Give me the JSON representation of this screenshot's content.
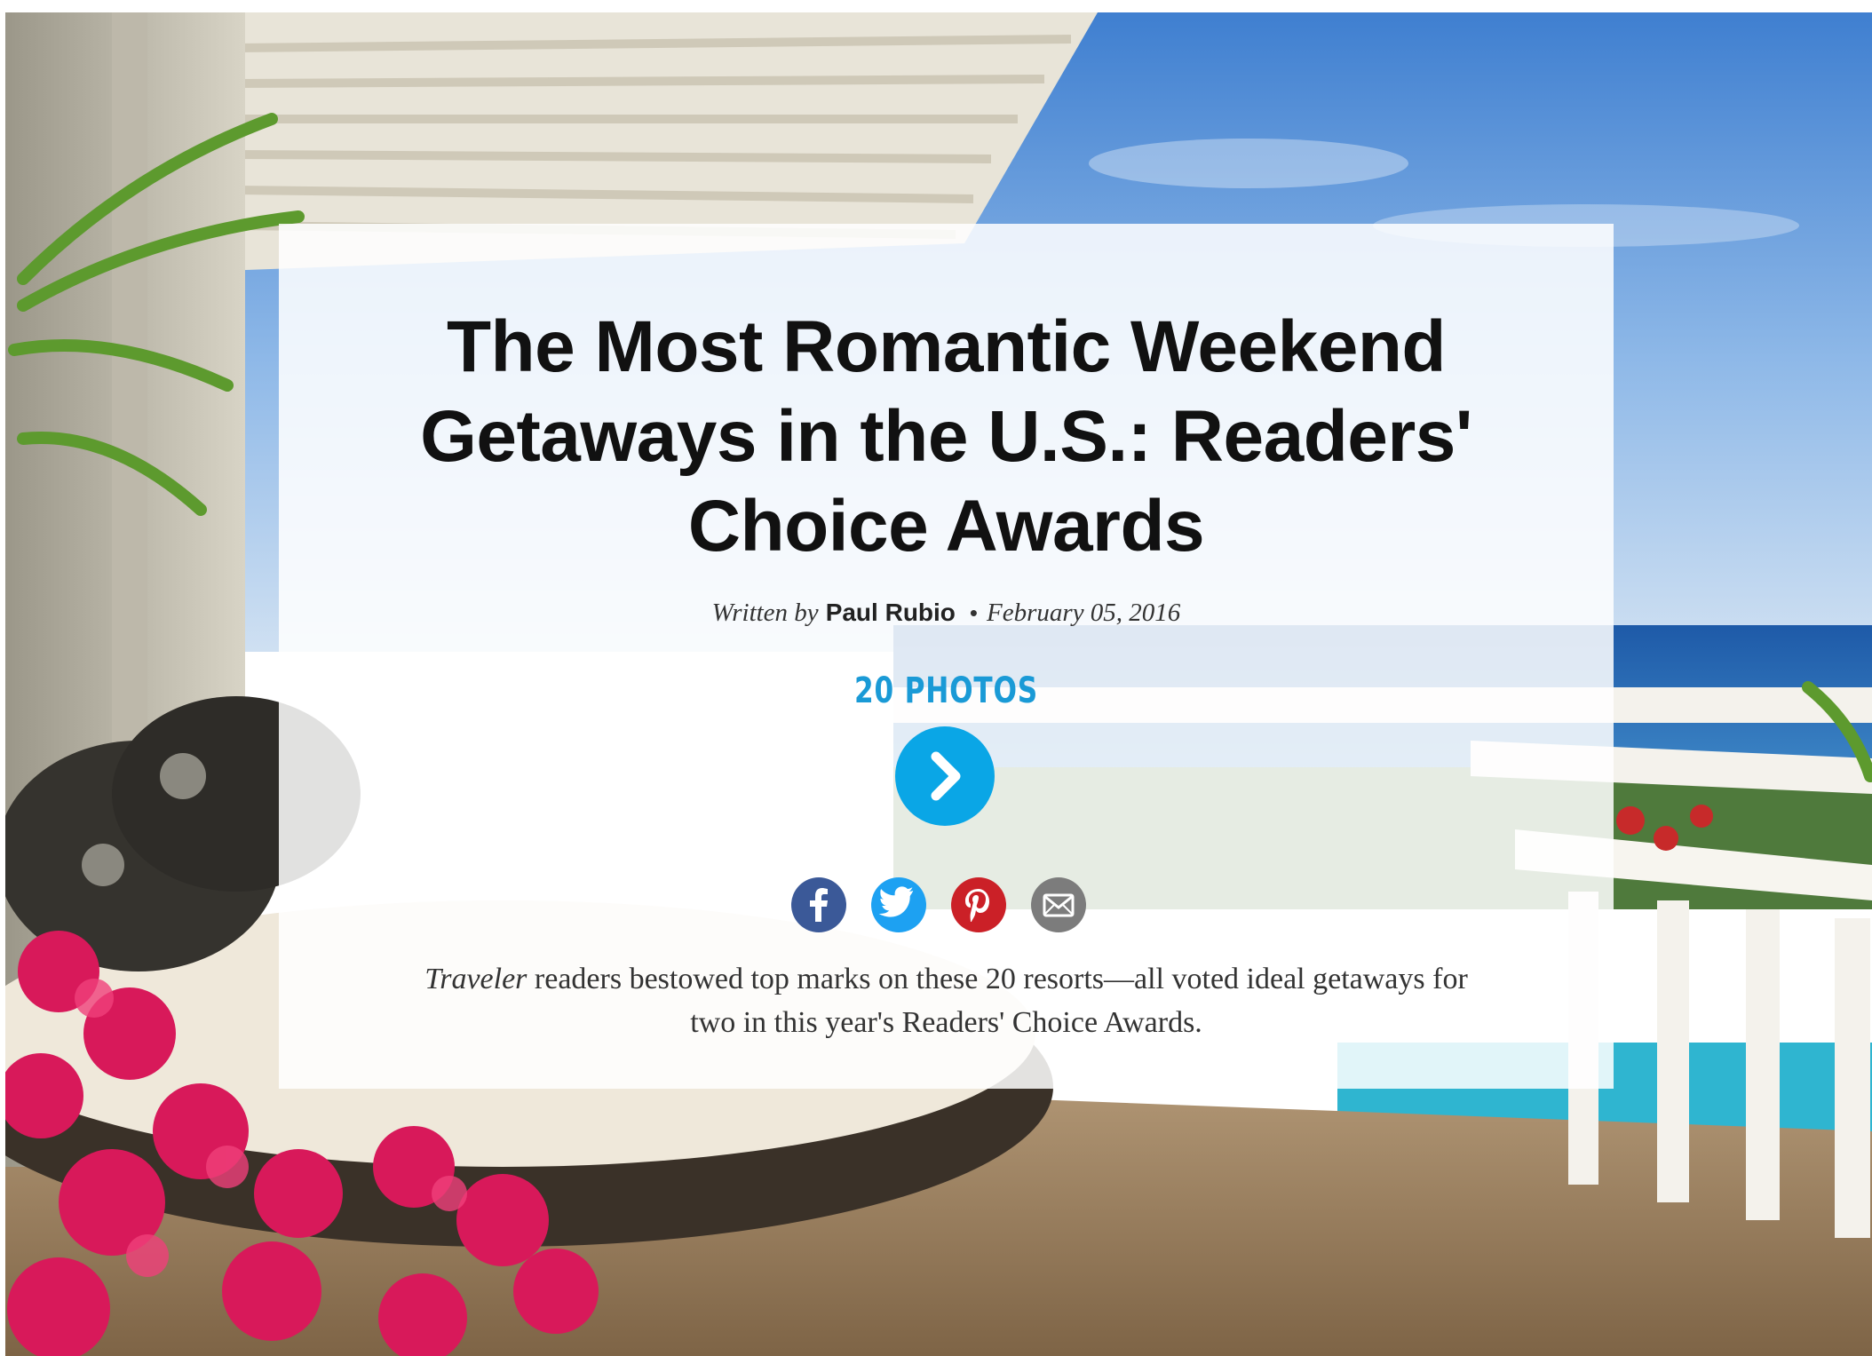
{
  "article": {
    "title": "The Most Romantic Weekend Getaways in the U.S.: Readers' Choice Awards",
    "byline": {
      "written_by": "Written by",
      "author": "Paul Rubio",
      "separator": "•",
      "date": "February 05, 2016"
    },
    "gallery": {
      "photo_count_label": "20 PHOTOS",
      "next_icon": "chevron-right-icon"
    },
    "share": [
      {
        "name": "facebook",
        "icon": "facebook-icon",
        "color": "#3b5998"
      },
      {
        "name": "twitter",
        "icon": "twitter-icon",
        "color": "#1da1f2"
      },
      {
        "name": "pinterest",
        "icon": "pinterest-icon",
        "color": "#cb2027"
      },
      {
        "name": "email",
        "icon": "envelope-icon",
        "color": "#7c7c7c"
      }
    ],
    "dek": {
      "publication": "Traveler",
      "text": " readers bestowed top marks on these 20 resorts—all voted ideal getaways for two in this year's Readers' Choice Awards."
    }
  },
  "colors": {
    "accent": "#1a9ad6",
    "button": "#0aa6e6"
  }
}
